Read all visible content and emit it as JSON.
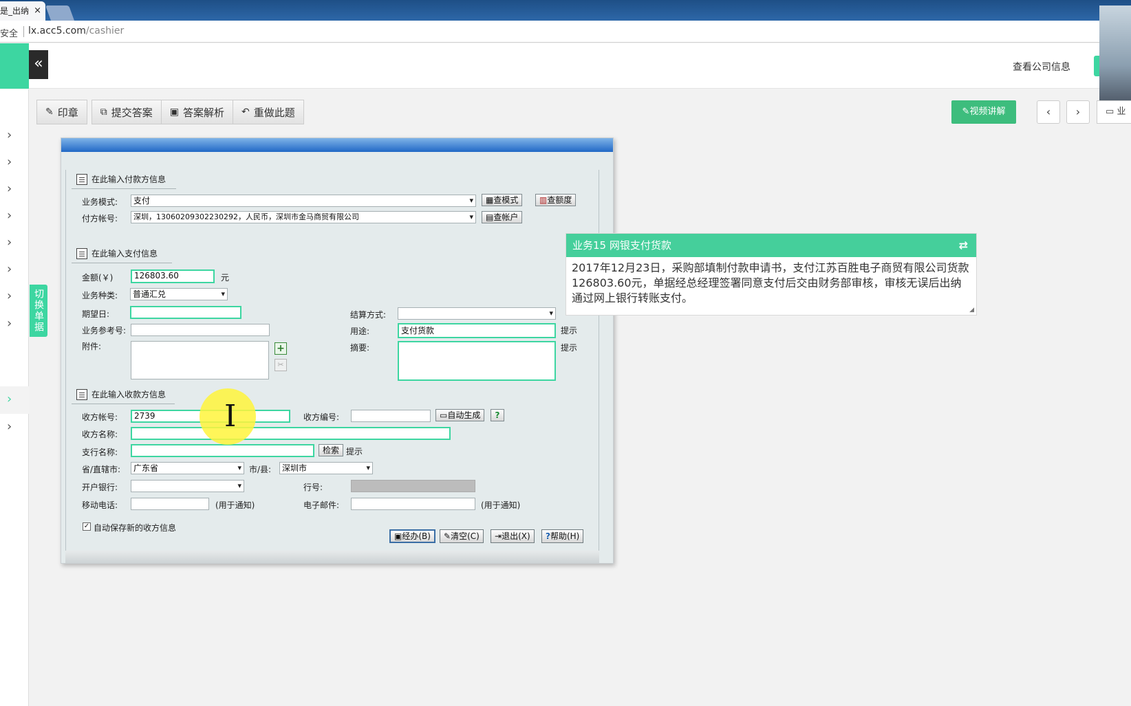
{
  "browser": {
    "tab_title": "是_出纳",
    "tab_close": "×",
    "secure_label": "安全",
    "url_host": "lx.acc5.com",
    "url_path": "/cashier"
  },
  "header": {
    "collapse_icon": "«",
    "company_info": "查看公司信息"
  },
  "sidebar": {
    "arrow_glyph": "›",
    "switch_label": "切换单据"
  },
  "toolbar": {
    "stamp": "印章",
    "submit": "提交答案",
    "analysis": "答案解析",
    "redo": "重做此题",
    "video": "视频讲解",
    "prev": "‹",
    "next": "›",
    "business": "业"
  },
  "form": {
    "payer_section": "在此输入付款方信息",
    "mode_label": "业务模式:",
    "mode_value": "支付",
    "query_mode_btn": "查模式",
    "query_quota_btn": "查额度",
    "payer_account_label": "付方帐号:",
    "payer_account_value": "深圳，13060209302230292，人民币，深圳市金马商贸有限公司",
    "query_account_btn": "查帐户",
    "payment_section": "在此输入支付信息",
    "amount_label": "金额(￥)",
    "amount_value": "126803.60",
    "amount_unit": "元",
    "biz_type_label": "业务种类:",
    "biz_type_value": "普通汇兑",
    "expect_date_label": "期望日:",
    "settle_label": "结算方式:",
    "ref_label": "业务参考号:",
    "purpose_label": "用途:",
    "purpose_value": "支付货款",
    "hint": "提示",
    "attach_label": "附件:",
    "summary_label": "摘要:",
    "payee_section": "在此输入收款方信息",
    "payee_account_label": "收方帐号:",
    "payee_account_value": "2739",
    "payee_code_label": "收方编号:",
    "auto_gen_btn": "自动生成",
    "help_q": "?",
    "payee_name_label": "收方名称:",
    "branch_label": "支行名称:",
    "search_btn": "检索",
    "province_label": "省/直辖市:",
    "province_value": "广东省",
    "city_label": "市/县:",
    "city_value": "深圳市",
    "bank_label": "开户银行:",
    "bank_no_label": "行号:",
    "mobile_label": "移动电话:",
    "notify_note": "(用于通知)",
    "email_label": "电子邮件:",
    "autosave_label": "自动保存新的收方信息",
    "btn_process": "经办(B)",
    "btn_clear": "清空(C)",
    "btn_exit": "退出(X)",
    "btn_help": "帮助(H)"
  },
  "task": {
    "title": "业务15 网银支付货款",
    "swap_icon": "⇄",
    "description": "2017年12月23日，采购部填制付款申请书，支付江苏百胜电子商贸有限公司货款126803.60元，单据经总经理签署同意支付后交由财务部审核，审核无误后出纳通过网上银行转账支付。"
  },
  "colors": {
    "accent": "#3dd6a1",
    "video_btn": "#3dbd7d",
    "titlebar": "#2168c6"
  }
}
